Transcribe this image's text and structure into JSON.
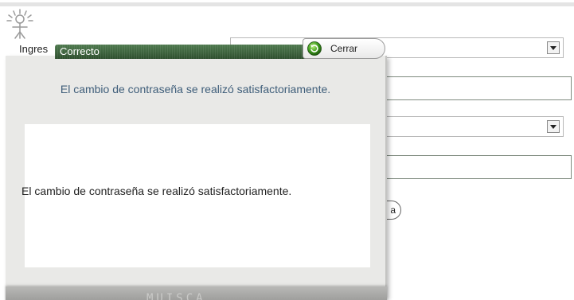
{
  "background": {
    "label_partial": "Ingres",
    "round_button_partial": "a"
  },
  "modal": {
    "title": "Correcto",
    "close_label": "Cerrar",
    "message": "El cambio de contraseña se realizó satisfactoriamente.",
    "content_text": "El cambio de contraseña se realizó satisfactoriamente.",
    "footer_logo_text": "MUISCA"
  },
  "icons": {
    "header_logo": "sun-figure-logo-icon",
    "close": "green-circle-arrow-icon",
    "dropdown": "chevron-down-icon"
  },
  "colors": {
    "title_bar": "#2e4f2e",
    "message_text": "#3f5e7a",
    "modal_bg": "#e9e9e7"
  }
}
